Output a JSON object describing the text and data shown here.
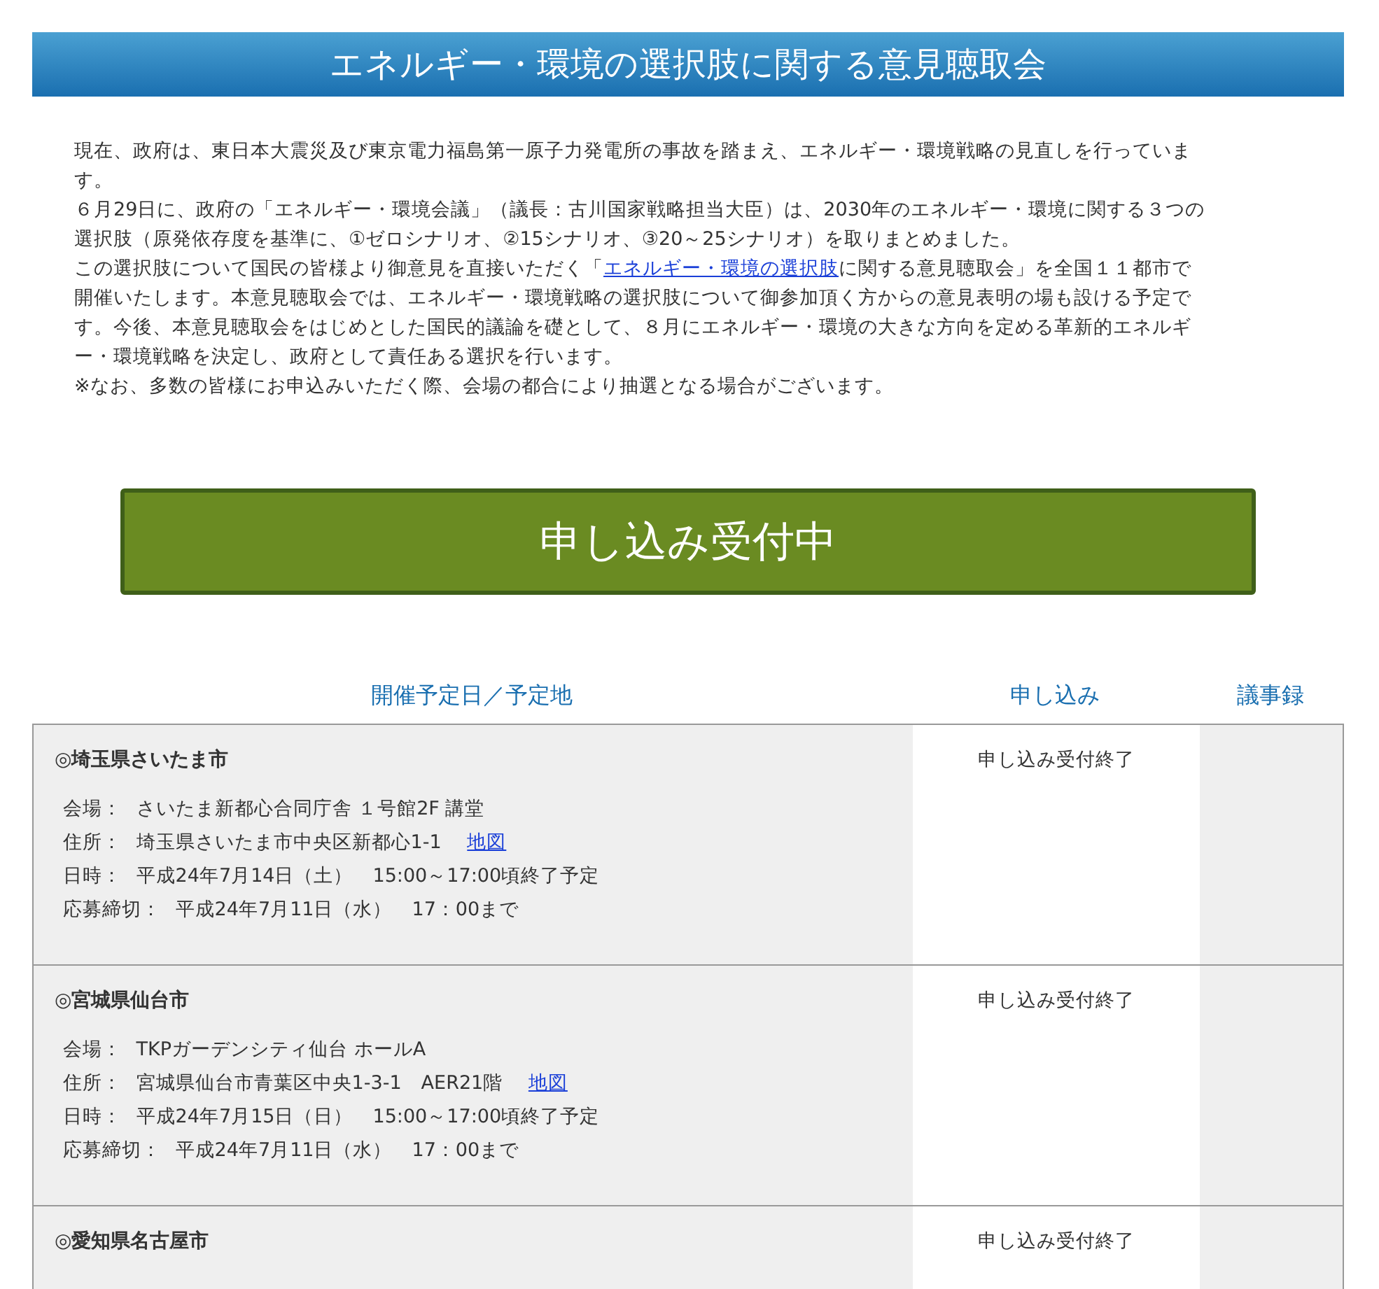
{
  "header": {
    "title": "エネルギー・環境の選択肢に関する意見聴取会"
  },
  "intro": [
    {
      "text": "現在、政府は、東日本大震災及び東京電力福島第一原子力発電所の事故を踏まえ、エネルギー・環境戦略の見直しを行っています。"
    },
    {
      "text": "６月29日に、政府の「エネルギー・環境会議」（議長：古川国家戦略担当大臣）は、2030年のエネルギー・環境に関する３つの選択肢（原発依存度を基準に、①ゼロシナリオ、②15シナリオ、③20～25シナリオ）を取りまとめました。"
    },
    {
      "text": "この選択肢について国民の皆様より御意見を直接いただく「",
      "link": "エネルギー・環境の選択肢",
      "after": "に関する意見聴取会」を全国１１都市で開催いたします。本意見聴取会では、エネルギー・環境戦略の選択肢について御参加頂く方からの意見表明の場も設ける予定です。今後、本意見聴取会をはじめとした国民的議論を礎として、８月にエネルギー・環境の大きな方向を定める革新的エネルギー・環境戦略を決定し、政府として責任ある選択を行います。"
    },
    {
      "text": "※なお、多数の皆様にお申込みいただく際、会場の都合により抽選となる場合がございます。"
    }
  ],
  "banner": {
    "label": "申し込み受付中"
  },
  "table": {
    "columns": [
      "開催予定日／予定地",
      "申し込み",
      "議事録"
    ],
    "rows": [
      {
        "name": "◎埼玉県さいたま市",
        "details": [
          {
            "label": "会場：",
            "value": "さいたま新都心合同庁舎 １号館2F 講堂"
          },
          {
            "label": "住所：",
            "value": "埼玉県さいたま市中央区新都心1-1",
            "link": "地図"
          },
          {
            "label": "日時：",
            "value": "平成24年7月14日（土）　15:00～17:00頃終了予定"
          },
          {
            "label": "応募締切：",
            "value": "平成24年7月11日（水）　17：00まで"
          }
        ],
        "status": "申し込み受付終了"
      },
      {
        "name": "◎宮城県仙台市",
        "details": [
          {
            "label": "会場：",
            "value": "TKPガーデンシティ仙台 ホールA"
          },
          {
            "label": "住所：",
            "value": "宮城県仙台市青葉区中央1-3-1　AER21階",
            "link": "地図"
          },
          {
            "label": "日時：",
            "value": "平成24年7月15日（日）　15:00～17:00頃終了予定"
          },
          {
            "label": "応募締切：",
            "value": "平成24年7月11日（水）　17：00まで"
          }
        ],
        "status": "申し込み受付終了"
      },
      {
        "name": "◎愛知県名古屋市",
        "details": [],
        "status": "申し込み受付終了"
      }
    ]
  }
}
